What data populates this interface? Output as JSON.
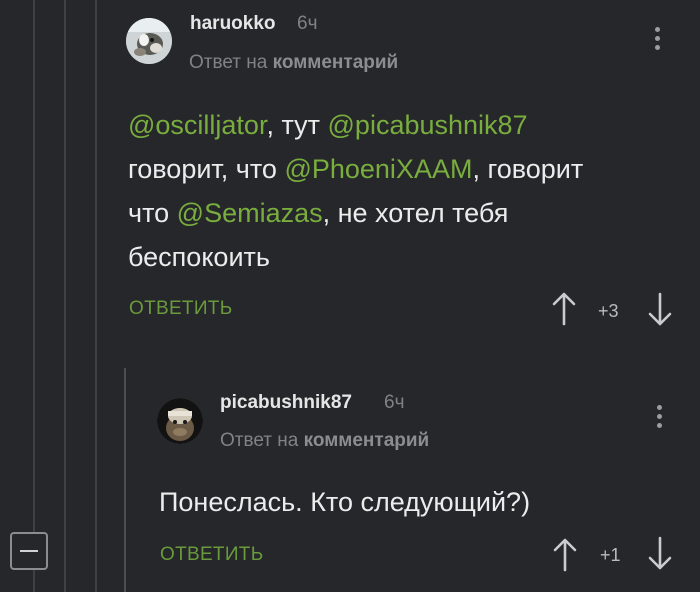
{
  "comments": [
    {
      "username": "haruokko",
      "time": "6ч",
      "reply_prefix": "Ответ на",
      "reply_link": "комментарий",
      "text": {
        "line1": [
          "@oscilljator",
          ", тут ",
          "@picabushnik87"
        ],
        "line2": [
          "говорит, что ",
          "@PhoeniXAAM",
          ", говорит"
        ],
        "line3": [
          "что ",
          "@Semiazas",
          ", не хотел тебя"
        ],
        "line4": "беспокоить"
      },
      "reply_label": "ОТВЕТИТЬ",
      "rating": "+3"
    },
    {
      "username": "picabushnik87",
      "time": "6ч",
      "reply_prefix": "Ответ на",
      "reply_link": "комментарий",
      "text": "Понеслась. Кто следующий?)",
      "reply_label": "ОТВЕТИТЬ",
      "rating": "+1"
    }
  ],
  "icons": {
    "more": "kebab-menu-icon",
    "up": "arrow-up-icon",
    "down": "arrow-down-icon",
    "collapse": "minus-icon"
  },
  "colors": {
    "background": "#25272a",
    "mention": "#79ad3e",
    "reply_button": "#6b9a3c",
    "muted": "#808386"
  }
}
